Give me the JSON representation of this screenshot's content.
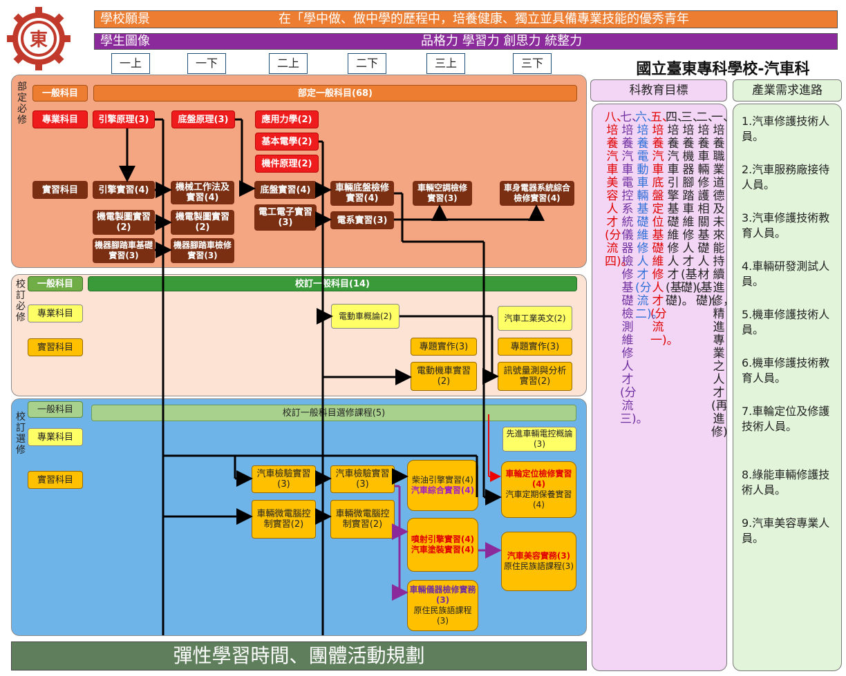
{
  "vision": {
    "label": "學校願景",
    "text": "在「學中做、做中學的歷程中，培養健康、獨立並具備專業技能的優秀青年"
  },
  "portrait": {
    "label": "學生圖像",
    "text": "品格力  學習力  創思力  統整力"
  },
  "semesters": [
    "一上",
    "一下",
    "二上",
    "二下",
    "三上",
    "三下"
  ],
  "school_title": "國立臺東專科學校-汽車科",
  "sections": {
    "dept_required": "部定必修",
    "school_required": "校訂必修",
    "school_elective": "校訂選修"
  },
  "row_labels": {
    "general": "一般科目",
    "professional": "專業科目",
    "practical": "實習科目"
  },
  "bars": {
    "dept_general": "部定一般科目(68)",
    "school_general": "校訂一般科目(14)",
    "school_general_elective": "校訂一般科目選修課程(5)",
    "flex": "彈性學習時間、團體活動規劃"
  },
  "courses": {
    "engine_theory": "引擎原理(3)",
    "chassis_theory": "底盤原理(3)",
    "applied_mechanics": "應用力學(2)",
    "basic_electricity": "基本電學(2)",
    "machine_parts": "機件原理(2)",
    "engine_practice": "引擎實習(4)",
    "machining": "機械工作法及實習(4)",
    "chassis_practice": "底盤實習(4)",
    "chassis_inspection": "車輛底盤檢修實習(4)",
    "ac_inspection": "車輛空調檢修實習(3)",
    "body_electrical": "車身電器系統綜合檢修實習(4)",
    "drafting1": "機電製圖實習(2)",
    "drafting2": "機電製圖實習(2)",
    "electronics": "電工電子實習(3)",
    "electrical_practice": "電系實習(3)",
    "motorcycle_basic": "機器腳踏車基礎實習(3)",
    "motorcycle_repair": "機器腳踏車檢修實習(3)",
    "ev_intro": "電動車概論(2)",
    "auto_english": "汽車工業英文(2)",
    "project1": "專題實作(3)",
    "project2": "專題實作(3)",
    "e_scooter": "電動機車實習(2)",
    "signal": "訊號量測與分析實習(2)",
    "advanced_control": "先進車輛電控概論(3)",
    "auto_inspect1": "汽車檢驗實習(3)",
    "auto_inspect2": "汽車檢驗實習(3)",
    "micro1": "車輛微電腦控制實習(2)",
    "micro2": "車輛微電腦控制實習(2)",
    "diesel": "柴油引擎實習(4)",
    "comprehensive": "汽車綜合實習(4)",
    "alignment": "車輪定位檢修實習(4)",
    "maintenance": "汽車定期保養實習(4)",
    "injection": "噴射引擎實習(4)",
    "painting": "汽車塗裝實習(4)",
    "beauty": "汽車美容實務(3)",
    "indigenous1": "原住民族語課程(3)",
    "instrument": "車輛儀器檢修實務(3)",
    "indigenous2": "原住民族語課程(3)"
  },
  "goals_header": "科教育目標",
  "goals": [
    {
      "num": "一",
      "text": "、培養職業道德及未來能持續進修，精進專業之人才(再進修)。",
      "color": "#222"
    },
    {
      "num": "二",
      "text": "、培養車輛修護相關基礎人材(基礎)。",
      "color": "#222"
    },
    {
      "num": "三",
      "text": "、培養機器腳踏車維修人才(基礎)。",
      "color": "#222"
    },
    {
      "num": "四",
      "text": "、培養汽車引擎基礎維修人才(基礎)。",
      "color": "#222"
    },
    {
      "num": "五",
      "text": "、培養汽車底盤定位基礎維修人才(分流一)。",
      "color": "#e00000"
    },
    {
      "num": "六",
      "text": "、培養電動車輛基礎維修人才(分流二)。",
      "color": "#2e6fd8"
    },
    {
      "num": "七",
      "text": "、培養汽車電控系統儀器檢修基礎檢測維修人才(分流三)。",
      "color": "#7030a0"
    },
    {
      "num": "八",
      "text": "、培養汽車美容人才(分流四)。",
      "color": "#e00000"
    }
  ],
  "career_header": "產業需求進路",
  "careers": [
    "1.汽車修護技術人員。",
    "2.汽車服務廠接待人員。",
    "3.汽車修護技術教育人員。",
    "4.車輛研發測試人員。",
    "5.機車修護技術人員。",
    "6.機車修護技術教育人員。",
    "7.車輪定位及修護技術人員。",
    "8.綠能車輛修護技術人員。",
    "9.汽車美容專業人員。"
  ],
  "colors": {
    "orange_banner": "#ed7d31",
    "purple_banner": "#8b2a9a",
    "dept_section": "#f4a582",
    "school_section": "#fde3d4",
    "elective_section": "#6fb4e8",
    "goals_bg": "#f3d6f5",
    "career_bg": "#e2f5da"
  },
  "icons": {
    "logo": "school-gear-logo"
  }
}
